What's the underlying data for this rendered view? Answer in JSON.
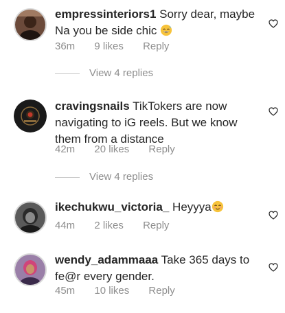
{
  "comments": [
    {
      "username": "empressinteriors1",
      "text": "Sorry dear, maybe Na you be side chic",
      "emoji": "grinning-sweat-emoji",
      "time": "36m",
      "likes": "9 likes",
      "reply": "Reply"
    },
    {
      "username": "cravingsnails",
      "text": "TikTokers are now navigating to iG reels. But we know them from a distance",
      "time": "42m",
      "likes": "20 likes",
      "reply": "Reply"
    },
    {
      "username": "ikechukwu_victoria_",
      "text": "Heyyya",
      "emoji": "smiling-blush-emoji",
      "time": "44m",
      "likes": "2 likes",
      "reply": "Reply"
    },
    {
      "username": "wendy_adammaaa",
      "text": "Take 365 days to fe@r every gender.",
      "time": "45m",
      "likes": "10 likes",
      "reply": "Reply"
    }
  ],
  "replies": [
    {
      "label": "View 4 replies"
    },
    {
      "label": "View 4 replies"
    }
  ],
  "colors": {
    "text": "#262626",
    "muted": "#8e8e8e",
    "divider": "#c7c7c7"
  }
}
